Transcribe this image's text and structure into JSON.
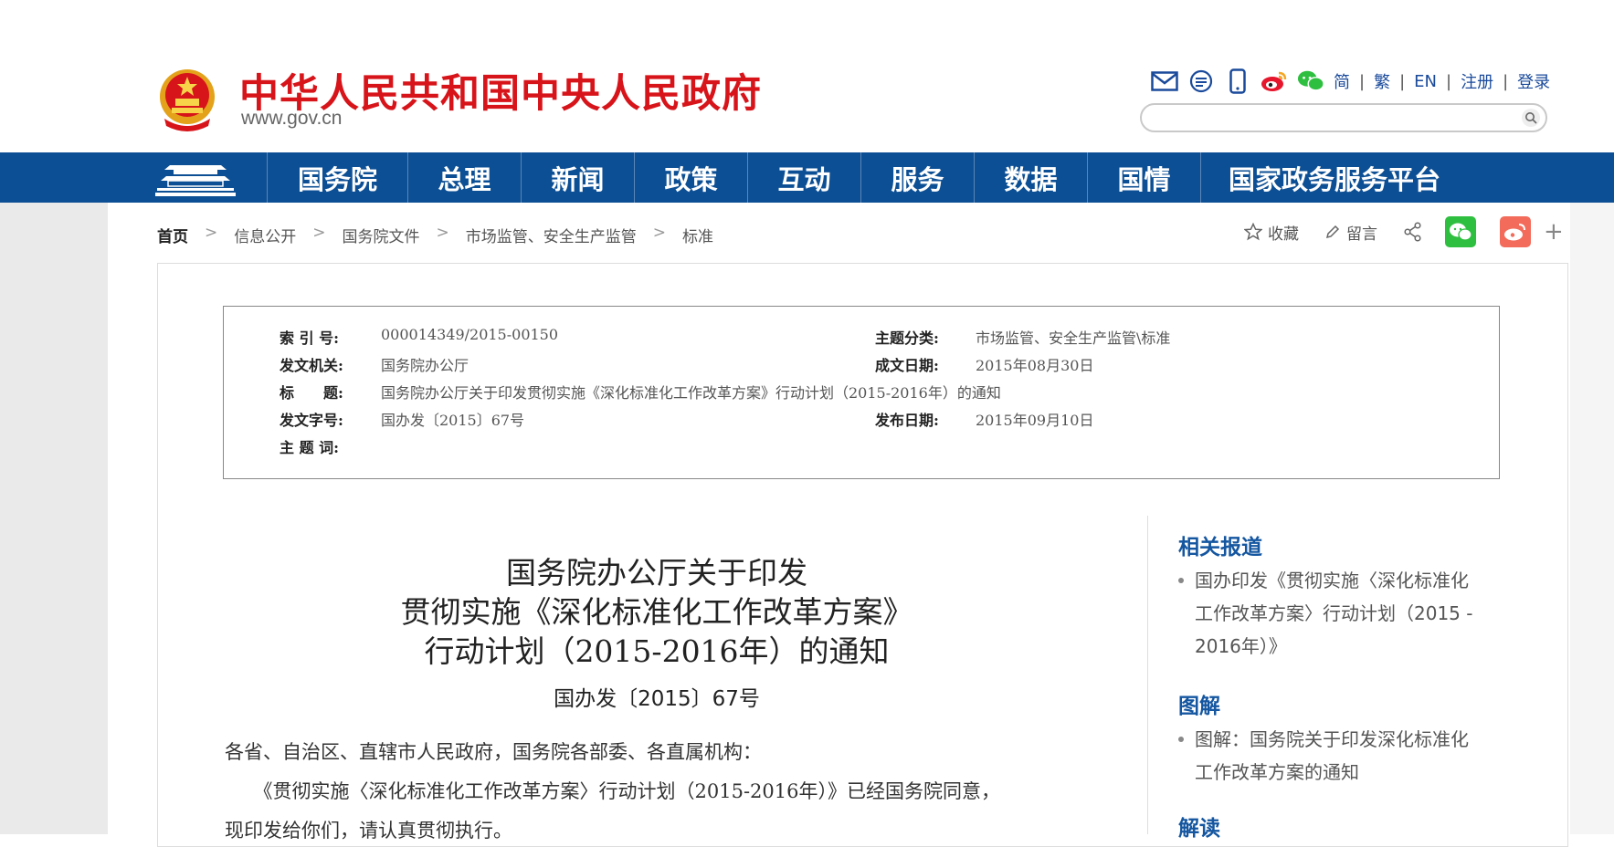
{
  "header": {
    "site_title": "中华人民共和国中央人民政府",
    "site_domain": "www.gov.cn",
    "icons": [
      "mail-icon",
      "message-icon",
      "mobile-icon",
      "weibo-icon",
      "wechat-icon"
    ],
    "lang_links": [
      "简",
      "繁",
      "EN",
      "注册",
      "登录"
    ],
    "search_placeholder": ""
  },
  "nav": {
    "items": [
      "国务院",
      "总理",
      "新闻",
      "政策",
      "互动",
      "服务",
      "数据",
      "国情",
      "国家政务服务平台"
    ]
  },
  "breadcrumb": {
    "home": "首页",
    "items": [
      "信息公开",
      "国务院文件",
      "市场监管、安全生产监管",
      "标准"
    ]
  },
  "actions": {
    "favorite": "收藏",
    "comment": "留言"
  },
  "meta": {
    "index_label": "索 引 号:",
    "index_value": "000014349/2015-00150",
    "topic_label": "主题分类:",
    "topic_value": "市场监管、安全生产监管\\标准",
    "issuer_label": "发文机关:",
    "issuer_value": "国务院办公厅",
    "created_label": "成文日期:",
    "created_value": "2015年08月30日",
    "title_label": "标　　题:",
    "title_value": "国务院办公厅关于印发贯彻实施《深化标准化工作改革方案》行动计划（2015-2016年）的通知",
    "docno_label": "发文字号:",
    "docno_value": "国办发〔2015〕67号",
    "published_label": "发布日期:",
    "published_value": "2015年09月10日",
    "keywords_label": "主 题 词:",
    "keywords_value": ""
  },
  "document": {
    "title_line1": "国务院办公厅关于印发",
    "title_line2": "贯彻实施《深化标准化工作改革方案》",
    "title_line3": "行动计划（2015-2016年）的通知",
    "number": "国办发〔2015〕67号",
    "para1": "各省、自治区、直辖市人民政府，国务院各部委、各直属机构：",
    "para2_line1": "　　《贯彻实施〈深化标准化工作改革方案〉行动计划（2015-2016年）》已经国务院同意，",
    "para2_line2": "现印发给你们，请认真贯彻执行。"
  },
  "sidebar": {
    "related_heading": "相关报道",
    "related_item_l1": "国办印发《贯彻实施〈深化标准化",
    "related_item_l2": "工作改革方案〉行动计划（2015 -",
    "related_item_l3": "2016年）》",
    "graphic_heading": "图解",
    "graphic_item_l1": "图解：国务院关于印发深化标准化",
    "graphic_item_l2": "工作改革方案的通知",
    "interpret_heading": "解读"
  },
  "colors": {
    "brand_red": "#d7141a",
    "nav_blue": "#0d4f94",
    "link_blue": "#1456a0"
  }
}
